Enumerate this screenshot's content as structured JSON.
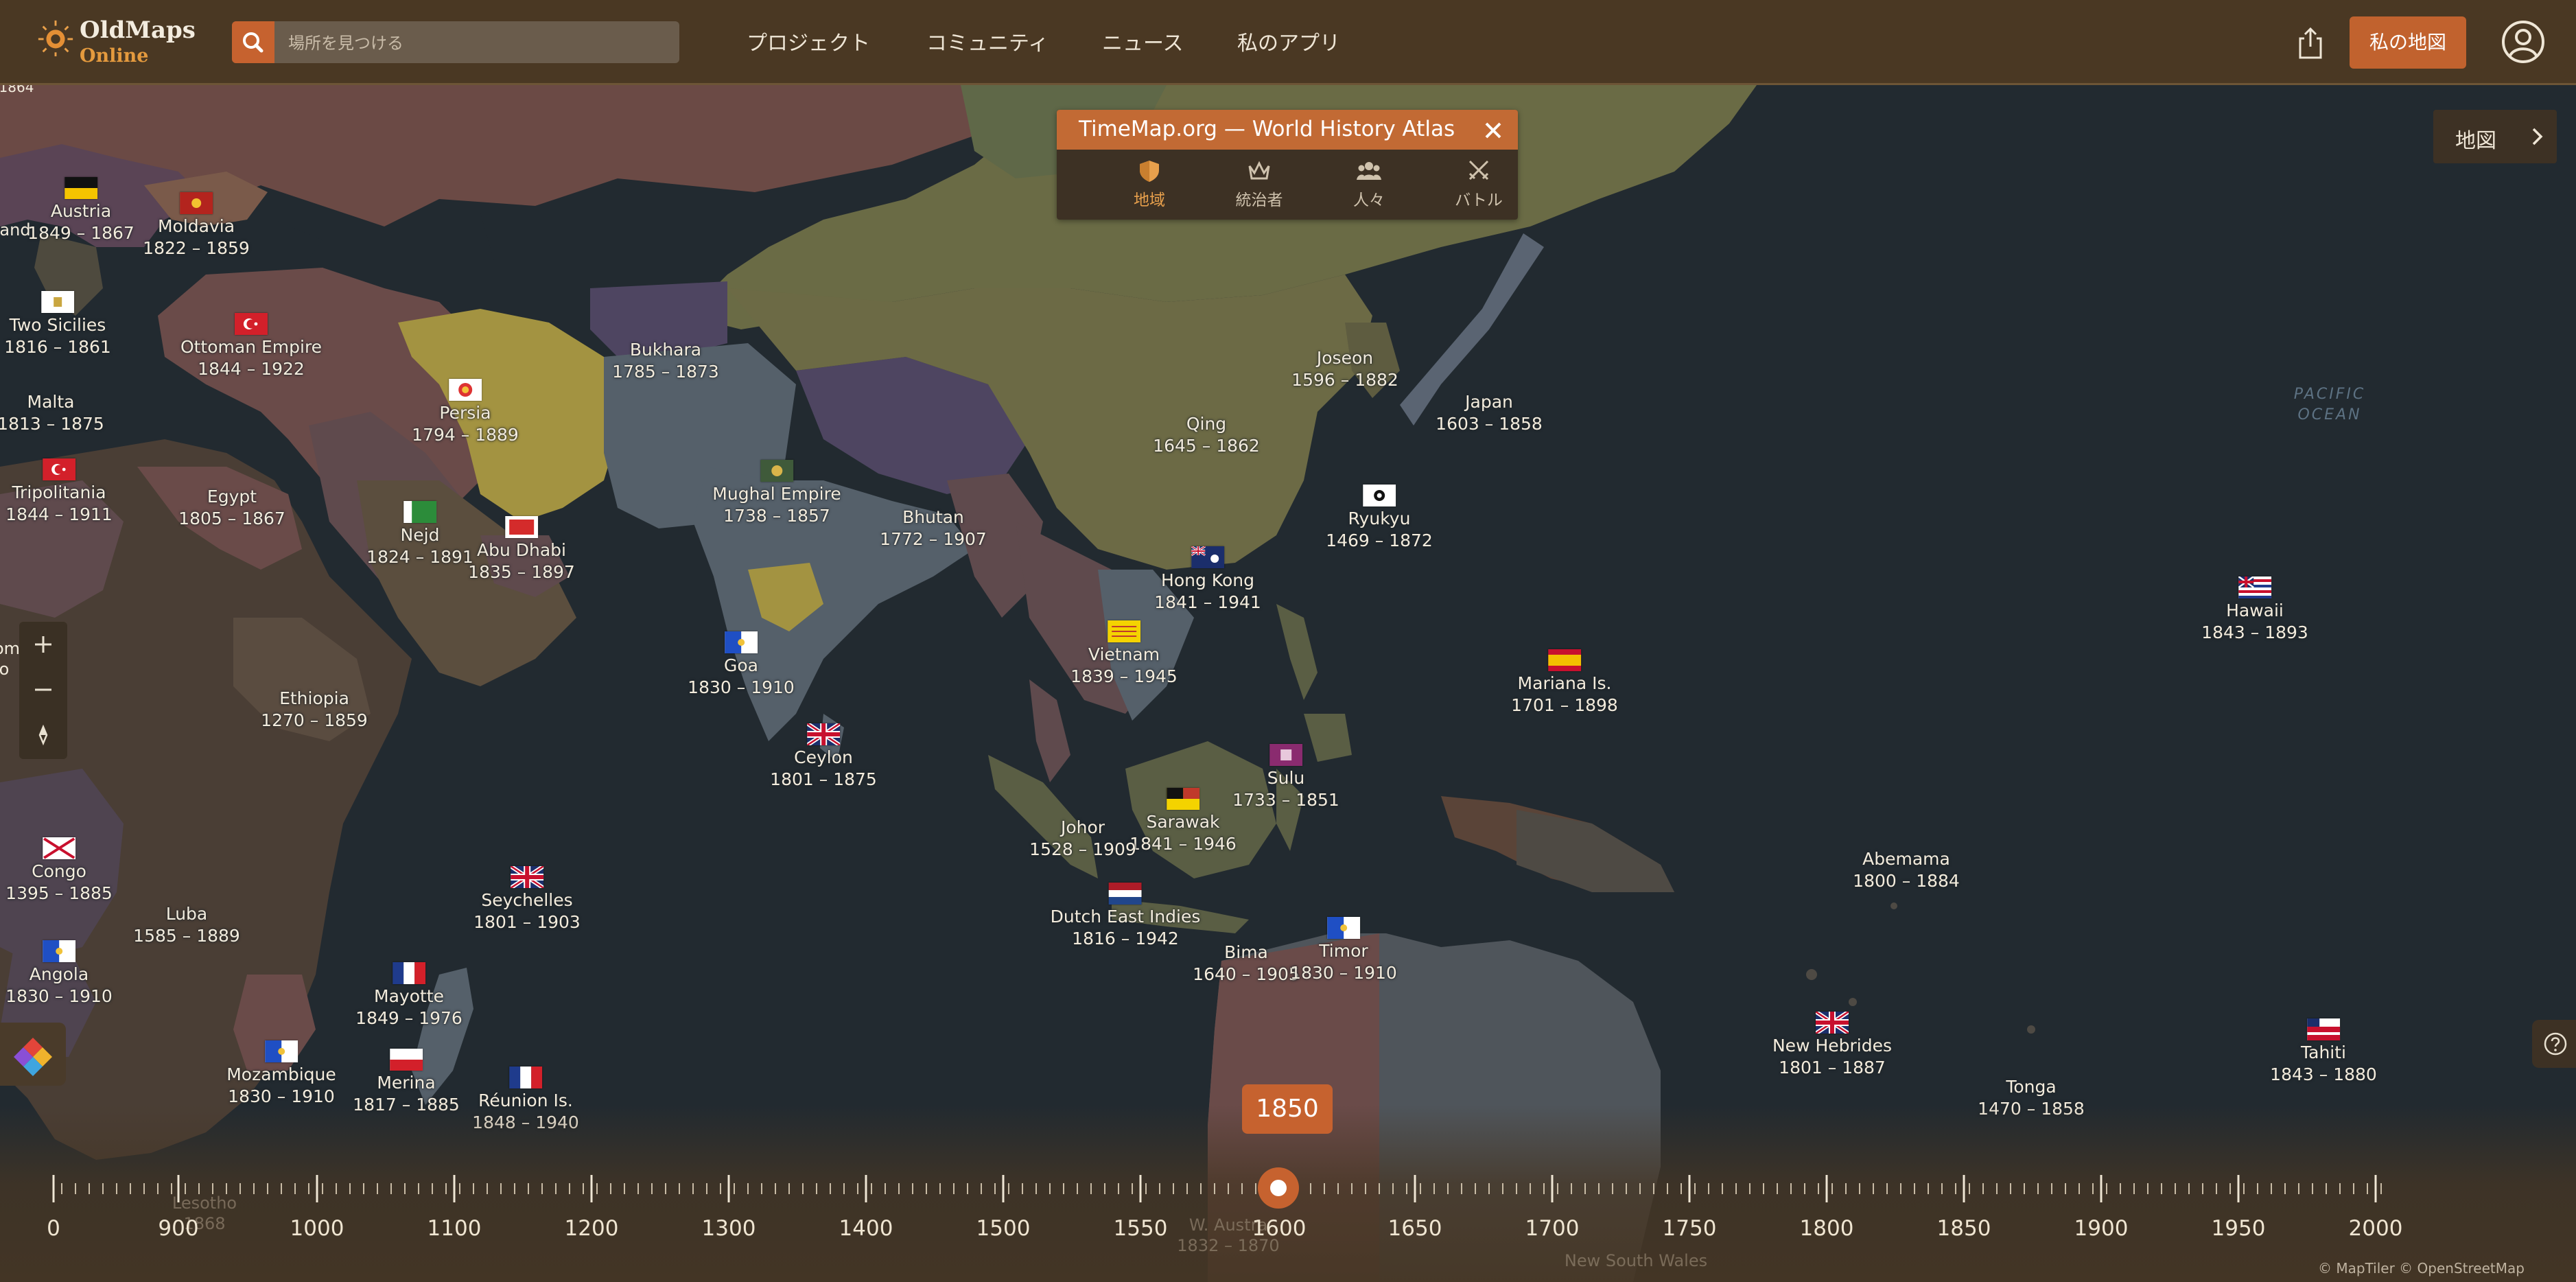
{
  "header": {
    "logo": {
      "line1": "OldMaps",
      "line2": "Online"
    },
    "search": {
      "placeholder": "場所を見つける"
    },
    "nav": [
      "プロジェクト",
      "コミュニティ",
      "ニュース",
      "私のアプリ"
    ],
    "my_maps_label": "私の地図"
  },
  "ocean_label": {
    "line1": "PACIFIC",
    "line2": "OCEAN"
  },
  "timemap_panel": {
    "title": "TimeMap.org — World History Atlas",
    "tabs": [
      {
        "label": "地域",
        "icon": "shield-icon",
        "active": true
      },
      {
        "label": "統治者",
        "icon": "crown-icon",
        "active": false
      },
      {
        "label": "人々",
        "icon": "people-icon",
        "active": false
      },
      {
        "label": "バトル",
        "icon": "crossed-swords-icon",
        "active": false
      }
    ]
  },
  "map_switch": {
    "label": "地図"
  },
  "places": [
    {
      "name": "Austria",
      "years": "1849 – 1867",
      "flag": "austria"
    },
    {
      "name": "Moldavia",
      "years": "1822 – 1859",
      "flag": "moldavia"
    },
    {
      "name": "Two Sicilies",
      "years": "1816 – 1861",
      "flag": "two-sicilies"
    },
    {
      "name": "Ottoman Empire",
      "years": "1844 – 1922",
      "flag": "ottoman"
    },
    {
      "name": "Malta",
      "years": "1813 – 1875",
      "flag": ""
    },
    {
      "name": "Tripolitania",
      "years": "1844 – 1911",
      "flag": "ottoman"
    },
    {
      "name": "Egypt",
      "years": "1805 – 1867",
      "flag": ""
    },
    {
      "name": "Bukhara",
      "years": "1785 – 1873",
      "flag": ""
    },
    {
      "name": "Persia",
      "years": "1794 – 1889",
      "flag": "persia"
    },
    {
      "name": "Nejd",
      "years": "1824 – 1891",
      "flag": "nejd"
    },
    {
      "name": "Abu Dhabi",
      "years": "1835 – 1897",
      "flag": "abu-dhabi"
    },
    {
      "name": "Mughal Empire",
      "years": "1738 – 1857",
      "flag": "mughal"
    },
    {
      "name": "Bhutan",
      "years": "1772 – 1907",
      "flag": ""
    },
    {
      "name": "Qing",
      "years": "1645 – 1862",
      "flag": ""
    },
    {
      "name": "Joseon",
      "years": "1596 – 1882",
      "flag": ""
    },
    {
      "name": "Japan",
      "years": "1603 – 1858",
      "flag": ""
    },
    {
      "name": "Ryukyu",
      "years": "1469 – 1872",
      "flag": "ryukyu"
    },
    {
      "name": "Hong Kong",
      "years": "1841 – 1941",
      "flag": "hong-kong"
    },
    {
      "name": "Vietnam",
      "years": "1839 – 1945",
      "flag": "vietnam"
    },
    {
      "name": "Goa",
      "years": "1830 – 1910",
      "flag": "portugal"
    },
    {
      "name": "Ceylon",
      "years": "1801 – 1875",
      "flag": "uk"
    },
    {
      "name": "Ethiopia",
      "years": "1270 – 1859",
      "flag": ""
    },
    {
      "name": "Hawaii",
      "years": "1843 – 1893",
      "flag": "hawaii"
    },
    {
      "name": "Mariana Is.",
      "years": "1701 – 1898",
      "flag": "spain"
    },
    {
      "name": "Sulu",
      "years": "1733 – 1851",
      "flag": "sulu"
    },
    {
      "name": "Sarawak",
      "years": "1841 – 1946",
      "flag": "sarawak"
    },
    {
      "name": "Johor",
      "years": "1528 – 1909",
      "flag": ""
    },
    {
      "name": "Congo",
      "years": "1395 – 1885",
      "flag": "congo"
    },
    {
      "name": "Seychelles",
      "years": "1801 – 1903",
      "flag": "uk"
    },
    {
      "name": "Luba",
      "years": "1585 – 1889",
      "flag": ""
    },
    {
      "name": "Angola",
      "years": "1830 – 1910",
      "flag": "portugal"
    },
    {
      "name": "Dutch East Indies",
      "years": "1816 – 1942",
      "flag": "netherlands"
    },
    {
      "name": "Bima",
      "years": "1640 – 1905",
      "flag": ""
    },
    {
      "name": "Timor",
      "years": "1830 – 1910",
      "flag": "portugal"
    },
    {
      "name": "Abemama",
      "years": "1800 – 1884",
      "flag": ""
    },
    {
      "name": "Mayotte",
      "years": "1849 – 1976",
      "flag": "france"
    },
    {
      "name": "Mozambique",
      "years": "1830 – 1910",
      "flag": "portugal"
    },
    {
      "name": "Merina",
      "years": "1817 – 1885",
      "flag": "merina"
    },
    {
      "name": "Réunion Is.",
      "years": "1848 – 1940",
      "flag": "france"
    },
    {
      "name": "New Hebrides",
      "years": "1801 – 1887",
      "flag": "uk"
    },
    {
      "name": "Tonga",
      "years": "1470 – 1858",
      "flag": ""
    },
    {
      "name": "Tahiti",
      "years": "1843 – 1880",
      "flag": "tahiti"
    }
  ],
  "partial_labels": {
    "west_edge_a": "and",
    "west_edge_b": "om",
    "west_edge_c": "o",
    "top_left_clip": "1864",
    "lesotho": {
      "name": "Lesotho",
      "years": "1868"
    },
    "w_australia": {
      "name": "W. Austra",
      "years": "1832 – 1870"
    },
    "nsw": {
      "name": "New South Wales"
    }
  },
  "timeline": {
    "current_year": "1850",
    "labels": [
      "0",
      "900",
      "1000",
      "1100",
      "1200",
      "1300",
      "1400",
      "1500",
      "1550",
      "1600",
      "1650",
      "1700",
      "1750",
      "1800",
      "1850",
      "1900",
      "1950",
      "2000"
    ],
    "selected": 1850
  },
  "attribution": "© MapTiler © OpenStreetMap",
  "colors": {
    "accent": "#c6622f",
    "header": "#4a3823",
    "panel": "#3d3124",
    "active_tab": "#e8a04c",
    "sea": "#222a30"
  }
}
